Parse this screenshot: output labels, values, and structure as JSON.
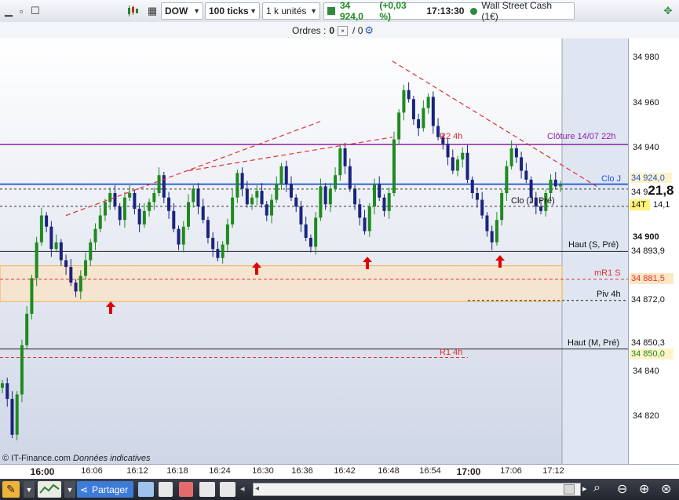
{
  "toolbar": {
    "instrument": "DOW",
    "interval": "100 ticks",
    "units": "1 k unités",
    "last_price": "34 924,0",
    "change": "(+0,03 %)",
    "time": "17:13:30",
    "product": "Wall Street Cash (1€)"
  },
  "orders": {
    "label": "Ordres :",
    "count": "0",
    "separator": "/ 0"
  },
  "chart_data": {
    "type": "candlestick",
    "x_ticks": [
      "16:00",
      "16:06",
      "16:12",
      "16:18",
      "16:24",
      "16:30",
      "16:36",
      "16:42",
      "16:48",
      "16:54",
      "17:00",
      "17:06",
      "17:12"
    ],
    "y_ticks": [
      34980,
      34960,
      34940,
      34900,
      34840,
      34820
    ],
    "ylim": [
      34805,
      34995
    ],
    "close_path": [
      34835,
      34828,
      34812,
      34830,
      34852,
      34866,
      34882,
      34898,
      34910,
      34905,
      34895,
      34898,
      34890,
      34887,
      34880,
      34876,
      34883,
      34890,
      34898,
      34904,
      34910,
      34916,
      34920,
      34914,
      34908,
      34918,
      34920,
      34913,
      34906,
      34912,
      34916,
      34920,
      34928,
      34918,
      34912,
      34904,
      34897,
      34905,
      34916,
      34922,
      34914,
      34908,
      34900,
      34895,
      34891,
      34897,
      34906,
      34918,
      34929,
      34922,
      34915,
      34918,
      34921,
      34915,
      34910,
      34917,
      34924,
      34932,
      34924,
      34918,
      34914,
      34906,
      34900,
      34896,
      34909,
      34923,
      34915,
      34922,
      34928,
      34940,
      34932,
      34922,
      34915,
      34909,
      34903,
      34914,
      34924,
      34918,
      34912,
      34920,
      34944,
      34956,
      34966,
      34962,
      34953,
      34949,
      34958,
      34963,
      34950,
      34945,
      34942,
      34936,
      34930,
      34935,
      34938,
      34926,
      34920,
      34917,
      34910,
      34903,
      34898,
      34908,
      34920,
      34932,
      34940,
      34936,
      34930,
      34926,
      34918,
      34914,
      34912,
      34920,
      34926,
      34923,
      34924
    ],
    "annotations": {
      "cloture": {
        "label": "Clôture 14/07 22h",
        "value": 34941.7
      },
      "clo_j": {
        "label": "Clo J",
        "value": 34924.0
      },
      "clo_j_pre": {
        "label": "Clo (J, Pré)",
        "value": 34914.1
      },
      "haut_s_pre": {
        "label": "Haut (S, Pré)",
        "value": 34893.9
      },
      "mr1_s": {
        "label": "mR1 S",
        "value": 34881.5
      },
      "piv_4h": {
        "label": "Piv 4h",
        "value": 34872.0
      },
      "haut_m_pre": {
        "label": "Haut (M, Pré)",
        "value": 34850.3
      },
      "r1_4h": {
        "label": "R1 4h",
        "value": 34846.5
      },
      "r2_4h": {
        "label": "R2 4h",
        "value": 34944.5
      }
    }
  },
  "price_boxes": {
    "clo_j": "34 924,0",
    "last": "34 9",
    "last_big": "21,8",
    "timer": "14T",
    "clo_j_pre": "14,1",
    "haut_s_pre": "34 893,9",
    "mr1_s": "34 881,5",
    "piv_4h": "34 872,0",
    "haut_m_pre": "34 850,3",
    "r1_4h": "34 850,0"
  },
  "footer": {
    "copyright": "© IT-Finance.com",
    "disclaimer": "Données indicatives",
    "share": "Partager"
  },
  "colors": {
    "bull": "#1f8a1f",
    "bear": "#1a237e",
    "cloture_line": "#8e24aa",
    "clo_line": "#1e4fd6",
    "zone": "#f3b04a",
    "red_text": "#e03030"
  }
}
